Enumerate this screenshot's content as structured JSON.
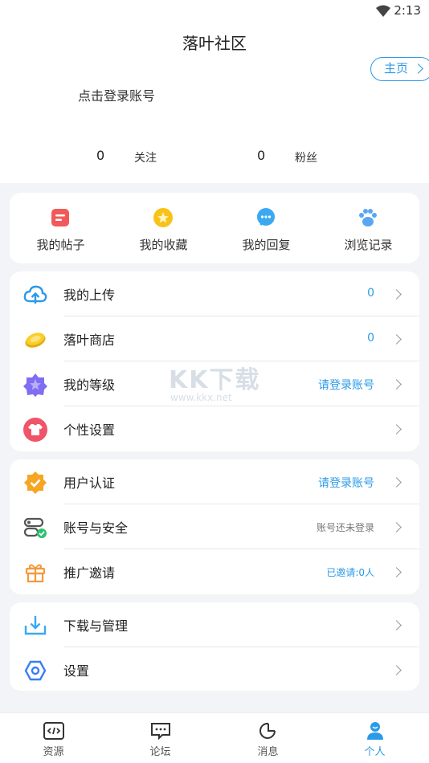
{
  "status": {
    "time": "2:13"
  },
  "header": {
    "title": "落叶社区",
    "home_button": "主页",
    "login_prompt": "点击登录账号",
    "following_count": "0",
    "following_label": "关注",
    "fans_count": "0",
    "fans_label": "粉丝"
  },
  "quick_actions": [
    {
      "label": "我的帖子",
      "icon": "posts-icon",
      "color": "#f25a5a"
    },
    {
      "label": "我的收藏",
      "icon": "star-icon",
      "color": "#f8c218"
    },
    {
      "label": "我的回复",
      "icon": "reply-icon",
      "color": "#3aa9f2"
    },
    {
      "label": "浏览记录",
      "icon": "paw-icon",
      "color": "#5aa6f2"
    }
  ],
  "group1": [
    {
      "label": "我的上传",
      "value": "0",
      "icon": "cloud-upload-icon"
    },
    {
      "label": "落叶商店",
      "value": "0",
      "icon": "coin-icon"
    },
    {
      "label": "我的等级",
      "value": "请登录账号",
      "icon": "level-star-icon"
    },
    {
      "label": "个性设置",
      "value": "",
      "icon": "tshirt-icon"
    }
  ],
  "group2": [
    {
      "label": "用户认证",
      "value": "请登录账号",
      "icon": "verified-badge-icon"
    },
    {
      "label": "账号与安全",
      "value": "账号还未登录",
      "icon": "account-security-icon"
    },
    {
      "label": "推广邀请",
      "value": "已邀请:0人",
      "icon": "gift-icon"
    }
  ],
  "group3": [
    {
      "label": "下载与管理",
      "value": "",
      "icon": "download-icon"
    },
    {
      "label": "设置",
      "value": "",
      "icon": "settings-hexagon-icon"
    }
  ],
  "tabs": [
    {
      "label": "资源",
      "icon": "code-icon"
    },
    {
      "label": "论坛",
      "icon": "chat-icon"
    },
    {
      "label": "消息",
      "icon": "message-icon"
    },
    {
      "label": "个人",
      "icon": "person-icon",
      "active": true
    }
  ],
  "watermark": {
    "text_a": "KK下载",
    "text_b": "www.kkx.net"
  },
  "colors": {
    "accent": "#2b9ae8",
    "background": "#f3f4f7"
  }
}
